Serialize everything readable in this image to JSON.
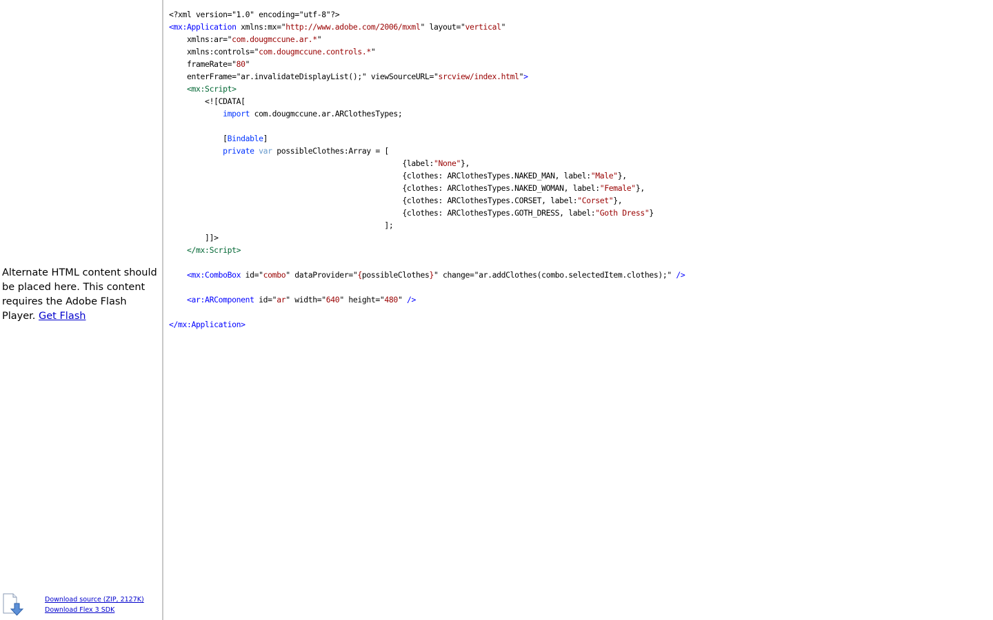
{
  "alt_content": {
    "text": "Alternate HTML content should be placed here. This content requires the Adobe Flash Player.",
    "link": "Get Flash"
  },
  "downloads": {
    "source": "Download source (ZIP, 2127K)",
    "sdk": "Download Flex 3 SDK"
  },
  "code": {
    "l1": "<?xml version=\"1.0\" encoding=\"utf-8\"?>",
    "l2_tag": "<mx:Application",
    "l2_attr1": " xmlns:mx=\"",
    "l2_val1": "http://www.adobe.com/2006/mxml",
    "l2_attr2": "\" layout=\"",
    "l2_val2": "vertical",
    "l2_end": "\"",
    "l3_attr": "    xmlns:ar=\"",
    "l3_val": "com.dougmccune.ar.*",
    "l3_end": "\"",
    "l4_attr": "    xmlns:controls=\"",
    "l4_val": "com.dougmccune.controls.*",
    "l4_end": "\"",
    "l5_attr": "    frameRate=\"",
    "l5_val": "80",
    "l5_end": "\"",
    "l6_attr1": "    enterFrame=\"ar.invalidateDisplayList();\" viewSourceURL=\"",
    "l6_val": "srcview/index.html",
    "l6_end": "\"",
    "l6_close": ">",
    "l7": "    <mx:Script>",
    "l8": "        <![CDATA[",
    "l9_kw": "import",
    "l9_rest": " com.dougmccune.ar.ARClothesTypes;",
    "l11_open": "            [",
    "l11_meta": "Bindable",
    "l11_close": "]",
    "l12_kw": "private",
    "l12_var": "var",
    "l12_rest": " possibleClothes:Array = [",
    "l13_pre": "                                                    {label:",
    "l13_val": "\"None\"",
    "l13_end": "},",
    "l14_pre": "                                                    {clothes: ARClothesTypes.NAKED_MAN, label:",
    "l14_val": "\"Male\"",
    "l14_end": "},",
    "l15_pre": "                                                    {clothes: ARClothesTypes.NAKED_WOMAN, label:",
    "l15_val": "\"Female\"",
    "l15_end": "},",
    "l16_pre": "                                                    {clothes: ARClothesTypes.CORSET, label:",
    "l16_val": "\"Corset\"",
    "l16_end": "},",
    "l17_pre": "                                                    {clothes: ARClothesTypes.GOTH_DRESS, label:",
    "l17_val": "\"Goth Dress\"",
    "l17_end": "}",
    "l18": "                                                ];",
    "l19": "        ]]>",
    "l20": "    </mx:Script>",
    "l22_tag": "    <mx:ComboBox",
    "l22_a1": " id=\"",
    "l22_v1": "combo",
    "l22_a2": "\" dataProvider=\"",
    "l22_b1": "{",
    "l22_v2": "possibleClothes",
    "l22_b2": "}",
    "l22_a3": "\" change=\"ar.addClothes(combo.selectedItem.clothes);\" ",
    "l22_close": "/>",
    "l24_tag": "    <ar:ARComponent",
    "l24_a1": " id=\"",
    "l24_v1": "ar",
    "l24_a2": "\" width=\"",
    "l24_v2": "640",
    "l24_a3": "\" height=\"",
    "l24_v3": "480",
    "l24_a4": "\" ",
    "l24_close": "/>",
    "l26": "</mx:Application>"
  }
}
